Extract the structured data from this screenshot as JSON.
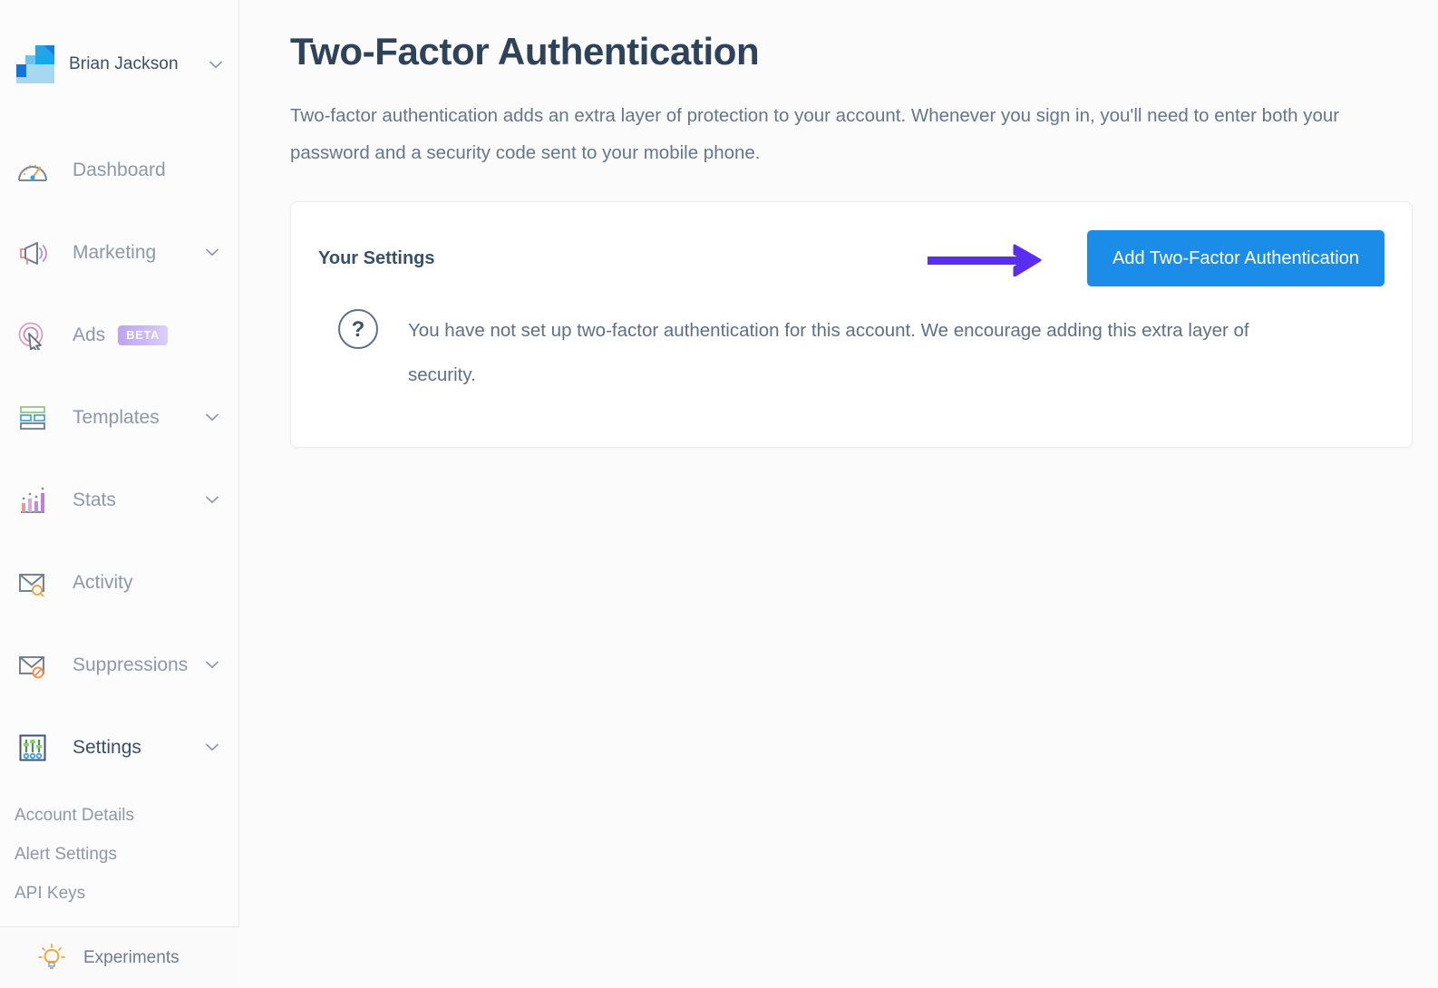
{
  "sidebar": {
    "account": {
      "name": "Brian Jackson",
      "logo_icon": "grid-squares-logo",
      "chevron_icon": "chevron-down-icon"
    },
    "items": [
      {
        "label": "Dashboard",
        "icon": "gauge-icon",
        "has_chevron": false,
        "badge": null,
        "active": false
      },
      {
        "label": "Marketing",
        "icon": "megaphone-icon",
        "has_chevron": true,
        "badge": null,
        "active": false
      },
      {
        "label": "Ads",
        "icon": "target-cursor-icon",
        "has_chevron": false,
        "badge": "BETA",
        "active": false
      },
      {
        "label": "Templates",
        "icon": "layout-icon",
        "has_chevron": true,
        "badge": null,
        "active": false
      },
      {
        "label": "Stats",
        "icon": "bar-chart-icon",
        "has_chevron": true,
        "badge": null,
        "active": false
      },
      {
        "label": "Activity",
        "icon": "envelope-search-icon",
        "has_chevron": false,
        "badge": null,
        "active": false
      },
      {
        "label": "Suppressions",
        "icon": "envelope-block-icon",
        "has_chevron": true,
        "badge": null,
        "active": false
      },
      {
        "label": "Settings",
        "icon": "sliders-icon",
        "has_chevron": true,
        "badge": null,
        "active": true
      }
    ],
    "settings_subitems": [
      {
        "label": "Account Details"
      },
      {
        "label": "Alert Settings"
      },
      {
        "label": "API Keys"
      }
    ],
    "footer": {
      "label": "Experiments",
      "icon": "lightbulb-icon"
    }
  },
  "main": {
    "title": "Two-Factor Authentication",
    "description": "Two-factor authentication adds an extra layer of protection to your account. Whenever you sign in, you'll need to enter both your password and a security code sent to your mobile phone.",
    "card": {
      "heading": "Your Settings",
      "button_label": "Add Two-Factor Authentication",
      "status_icon": "question-mark-circle-icon",
      "status_message": "You have not set up two-factor authentication for this account. We encourage adding this extra layer of security.",
      "annotation_arrow_icon": "right-arrow-annotation"
    }
  },
  "colors": {
    "button_blue": "#1b8ce8",
    "arrow_purple": "#5a2ef0",
    "title_navy": "#2e4259",
    "body_text": "#667689",
    "muted_text": "#8d98a8",
    "page_background": "#fbfbfc",
    "card_background": "#ffffff",
    "badge_purple": "#c3aef2"
  }
}
